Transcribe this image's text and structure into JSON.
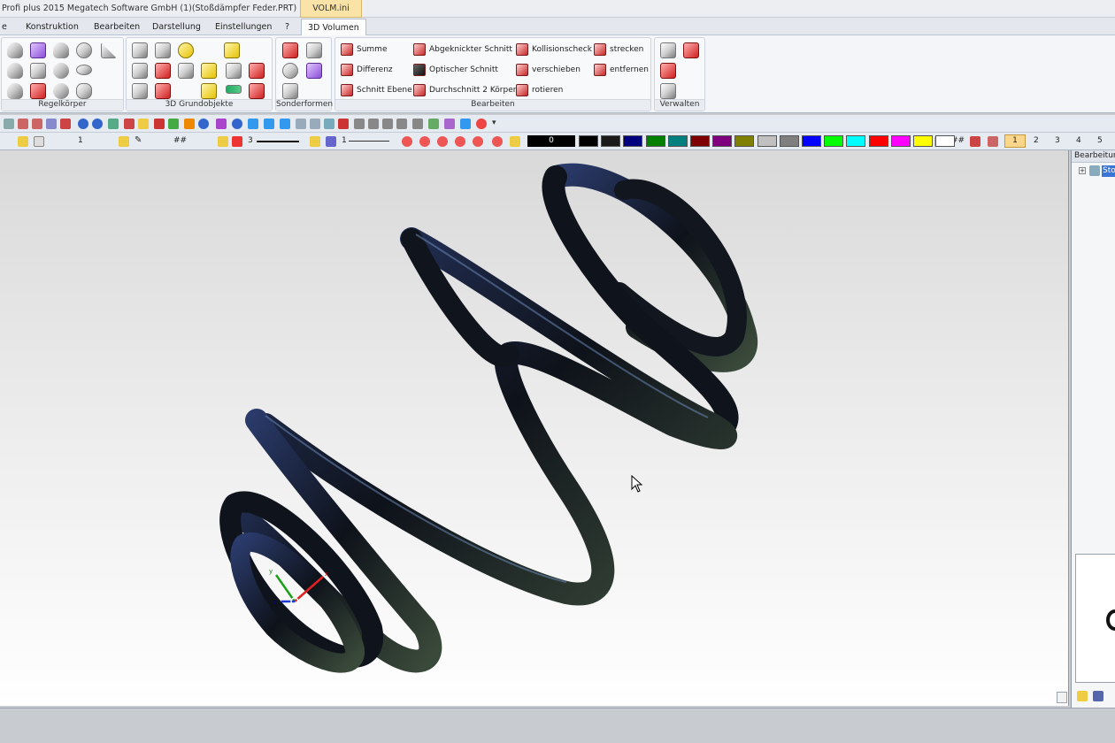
{
  "window": {
    "title": "Profi plus 2015  Megatech Software GmbH (1)(Stoßdämpfer Feder.PRT)",
    "context_tab": "VOLM.ini"
  },
  "tabs": [
    {
      "label": "e"
    },
    {
      "label": "Konstruktion"
    },
    {
      "label": "Bearbeiten"
    },
    {
      "label": "Darstellung"
    },
    {
      "label": "Einstellungen"
    },
    {
      "label": "?"
    },
    {
      "label": "3D Volumen"
    }
  ],
  "ribbon": {
    "groups": [
      {
        "label": "Regelkörper"
      },
      {
        "label": "3D Grundobjekte"
      },
      {
        "label": "Sonderformen"
      },
      {
        "label": "Bearbeiten"
      },
      {
        "label": "Verwalten"
      }
    ],
    "bearbeiten_commands": [
      "Summe",
      "Differenz",
      "Schnitt Ebene",
      "Abgeknickter Schnitt",
      "Optischer Schnitt",
      "Durchschnitt 2 Körper",
      "Kollisionscheck",
      "verschieben",
      "rotieren",
      "strecken",
      "entfernen"
    ]
  },
  "toolbar2": {
    "layer": "1",
    "hatch": "##",
    "line_width": "3",
    "line_type": "1",
    "color_value": "0",
    "hash_label": "##",
    "page_selected": "1",
    "pages": [
      "2",
      "3",
      "4",
      "5"
    ]
  },
  "colors": {
    "palette": [
      "#000000",
      "#1a1a1a",
      "#00007f",
      "#007f00",
      "#007f7f",
      "#7f0000",
      "#7f007f",
      "#7f7f00",
      "#c0c0c0",
      "#7f7f7f",
      "#0000ff",
      "#00ff00",
      "#00ffff",
      "#ff0000",
      "#ff00ff",
      "#ffff00",
      "#ffffff"
    ],
    "accent_tab": "#f9e3a6",
    "spring": "#1c2230"
  },
  "right_panel": {
    "title": "Bearbeitung",
    "tree_item": "Sto"
  },
  "viewport": {
    "axes": [
      "x",
      "y",
      "z"
    ]
  }
}
